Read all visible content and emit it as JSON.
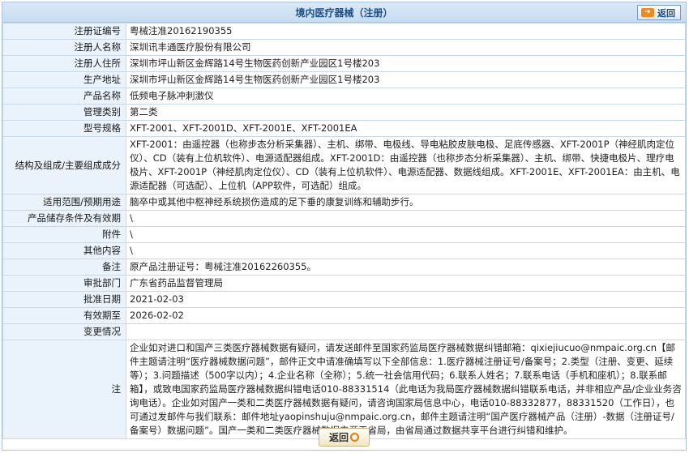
{
  "header": {
    "title": "境内医疗器械（注册）",
    "back_label": "返回"
  },
  "rows": [
    {
      "label": "注册证编号",
      "value": "粤械注准20162190355"
    },
    {
      "label": "注册人名称",
      "value": "深圳讯丰通医疗股份有限公司"
    },
    {
      "label": "注册人住所",
      "value": "深圳市坪山新区金辉路14号生物医药创新产业园区1号楼203"
    },
    {
      "label": "生产地址",
      "value": "深圳市坪山新区金辉路14号生物医药创新产业园区1号楼203"
    },
    {
      "label": "产品名称",
      "value": "低频电子脉冲刺激仪"
    },
    {
      "label": "管理类别",
      "value": "第二类"
    },
    {
      "label": "型号规格",
      "value": "XFT-2001、XFT-2001D、XFT-2001E、XFT-2001EA"
    },
    {
      "label": "结构及组成/主要组成成分",
      "value": "XFT-2001：由遥控器（也称步态分析采集器）、主机、绑带、电极线、导电粘胶皮肤电极、足底传感器、XFT-2001P（神经肌肉定位仪）、CD（装有上位机软件）、电源适配器组成。XFT-2001D：由遥控器（也称步态分析采集器）、主机、绑带、快捷电极片、理疗电极片、XFT-2001P（神经肌肉定位仪）、CD（装有上位机软件）、电源适配器、数据线组成。XFT-2001E、XFT-2001EA：由主机、电源适配器（可选配）、上位机（APP软件，可选配）组成。"
    },
    {
      "label": "适用范围/预期用途",
      "value": "脑卒中或其他中枢神经系统损伤造成的足下垂的康复训练和辅助步行。"
    },
    {
      "label": "产品储存条件及有效期",
      "value": "\\"
    },
    {
      "label": "附件",
      "value": "\\"
    },
    {
      "label": "其他内容",
      "value": "\\"
    },
    {
      "label": "备注",
      "value": "原产品注册证号：粤械注准20162260355。"
    },
    {
      "label": "审批部门",
      "value": "广东省药品监督管理局"
    },
    {
      "label": "批准日期",
      "value": "2021-02-03"
    },
    {
      "label": "有效期至",
      "value": "2026-02-02"
    },
    {
      "label": "变更情况",
      "value": ""
    }
  ],
  "note": {
    "label": "注",
    "text": "企业如对进口和国产三类医疗器械数据有疑问，请发送邮件至国家药监局医疗器械数据纠错邮箱：qixiejiucuo@nmpaic.org.cn【邮件主题请注明“医疗器械数据问题”，邮件正文中请准确填写以下全部信息：1.医疗器械注册证号/备案号；2.类型（注册、变更、延续等）；3.问题描述（500字以内）；4.企业名称（全称）；5.统一社会信用代码；6.联系人姓名；7.联系电话（手机和座机）；8.联系邮箱】，或致电国家药监局医疗器械数据纠错电话010-88331514（此电话为我局医疗器械数据纠错联系电话，并非相应产品/企业业务咨询电话）。企业如对国产一类和二类医疗器械数据有疑问，请咨询国家局信息中心，电话010-88332877，88331520（工作日），也可通过发邮件与我们联系：邮件地址yaopinshuju@nmpaic.org.cn，邮件主题请注明“国产医疗器械产品（注册）-数据（注册证号/备案号）数据问题”。国产一类和二类医疗器械数据来源于省局，由省局通过数据共享平台进行纠错和维护。"
  },
  "footer": {
    "back_label": "返回"
  }
}
